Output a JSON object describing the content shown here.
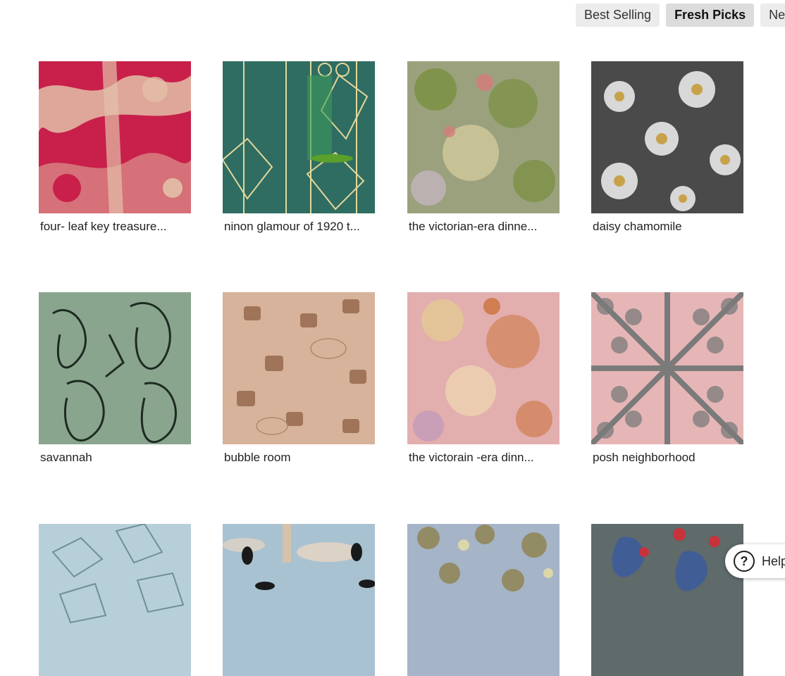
{
  "sort_tabs": [
    {
      "label": "Best Selling",
      "active": false
    },
    {
      "label": "Fresh Picks",
      "active": true
    },
    {
      "label": "New",
      "active": false
    }
  ],
  "products": [
    {
      "title": "four- leaf key treasure...",
      "colors": [
        "#c8204a",
        "#e3c0a8"
      ]
    },
    {
      "title": "ninon glamour of 1920 t...",
      "colors": [
        "#2f6d62",
        "#e2d79a"
      ]
    },
    {
      "title": "the victorian-era dinne...",
      "colors": [
        "#9ba17d",
        "#6e8a2a"
      ]
    },
    {
      "title": "daisy chamomile",
      "colors": [
        "#4a4a4a",
        "#d8d8d8"
      ]
    },
    {
      "title": "savannah",
      "colors": [
        "#8aa58e",
        "#1d2b22"
      ]
    },
    {
      "title": "bubble room",
      "colors": [
        "#d6b39a",
        "#8a5a3e"
      ]
    },
    {
      "title": "the victorain -era dinn...",
      "colors": [
        "#e3aeae",
        "#c86a2a"
      ]
    },
    {
      "title": "posh neighborhood",
      "colors": [
        "#e6b6b6",
        "#7a7a7a"
      ]
    },
    {
      "title": "",
      "colors": [
        "#b7cfd8",
        "#6f8f9a"
      ]
    },
    {
      "title": "",
      "colors": [
        "#a9c2d2",
        "#1a1a1a"
      ]
    },
    {
      "title": "",
      "colors": [
        "#a6b4c8",
        "#8a7a3a"
      ]
    },
    {
      "title": "",
      "colors": [
        "#5f6a6a",
        "#3a5aa0"
      ]
    }
  ],
  "help": {
    "label": "Help",
    "icon": "question-icon"
  }
}
